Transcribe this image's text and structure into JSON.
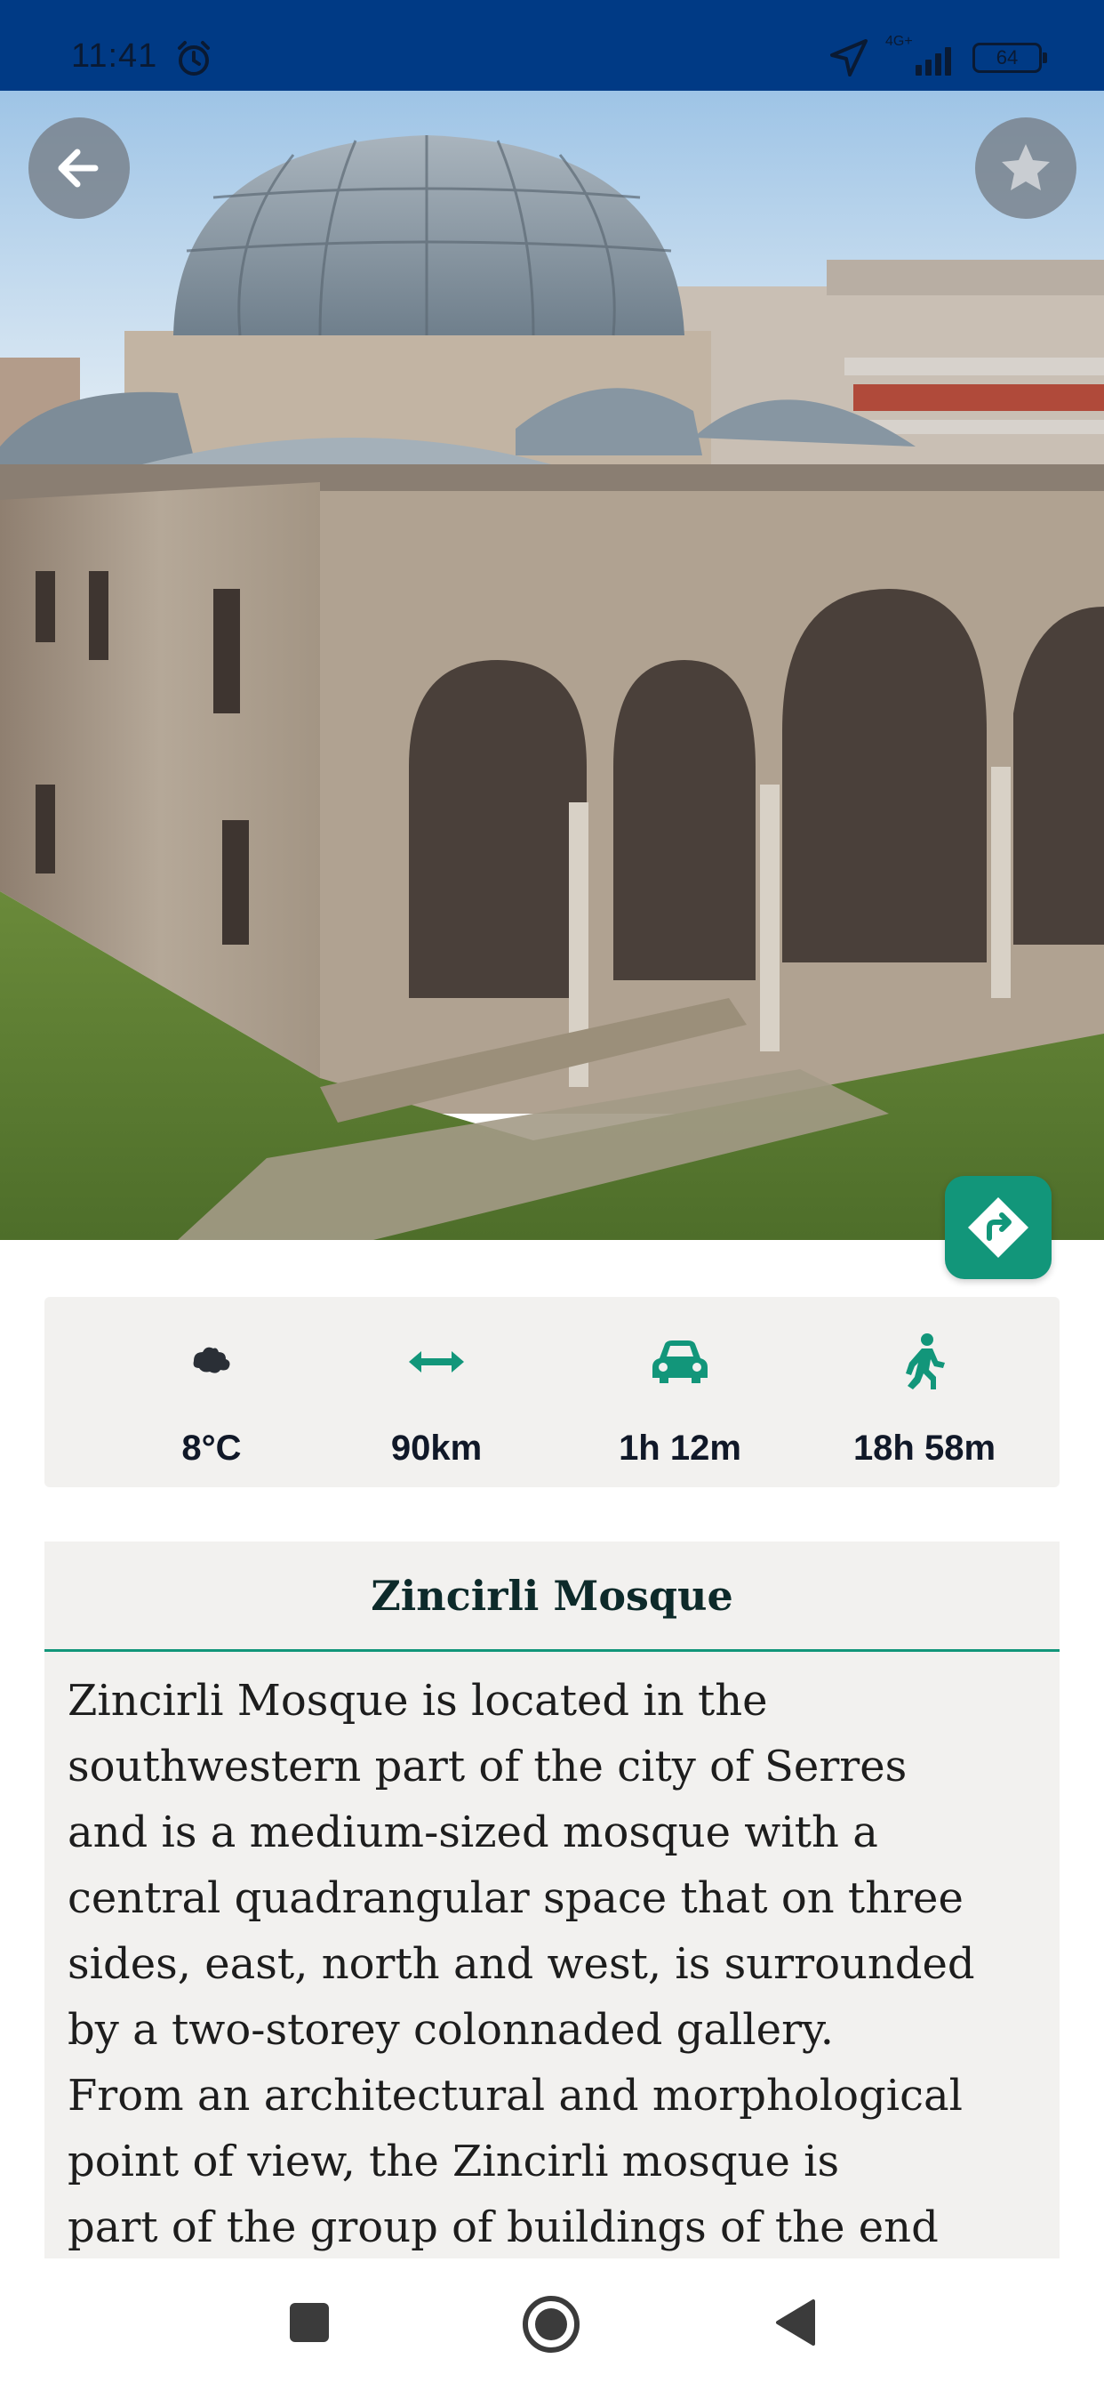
{
  "status_bar": {
    "time": "11:41",
    "network": "4G+",
    "battery": "64"
  },
  "header": {
    "back_icon": "arrow-left-icon",
    "favorite_icon": "star-icon",
    "directions_icon": "turn-right-icon"
  },
  "stats": {
    "weather": {
      "icon": "cloud-icon",
      "value": "8°C"
    },
    "distance": {
      "icon": "double-arrow-icon",
      "value": "90km"
    },
    "drive": {
      "icon": "car-icon",
      "value": "1h 12m"
    },
    "walk": {
      "icon": "walking-person-icon",
      "value": "18h 58m"
    }
  },
  "place": {
    "title": "Zincirli Mosque",
    "description": "Zincirli Mosque is located in the\nsouthwestern part of the city of Serres\nand is a medium-sized mosque with a\ncentral quadrangular space that on three\nsides, east, north and west, is surrounded\nby a two-storey colonnaded gallery.\nFrom an architectural and morphological\npoint of view, the Zincirli mosque is\npart of the group of buildings of the end"
  },
  "colors": {
    "status_bar": "#003a85",
    "accent": "#12967a",
    "card_bg": "#f2f1ef",
    "text_dark": "#101828"
  },
  "nav_bar": {
    "recents_icon": "square-icon",
    "home_icon": "circle-icon",
    "back_icon": "triangle-back-icon"
  }
}
